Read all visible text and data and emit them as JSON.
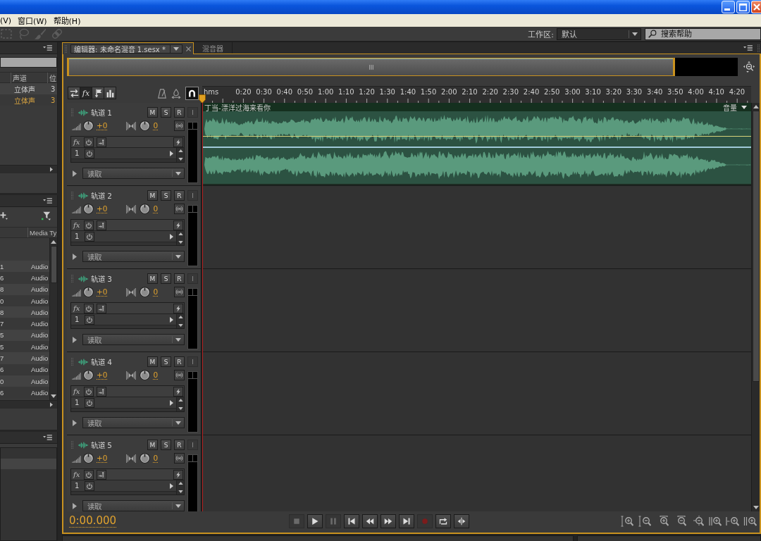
{
  "window": {
    "controls": [
      {
        "kind": "minimize"
      },
      {
        "kind": "maximize"
      },
      {
        "kind": "close"
      }
    ]
  },
  "menu_bar": {
    "items": [
      {
        "label": "(V)"
      },
      {
        "label": "窗口(W)"
      },
      {
        "label": "帮助(H)"
      }
    ]
  },
  "toolbar": {
    "tools": [
      {
        "kind": "marquee",
        "disabled": true
      },
      {
        "kind": "lasso",
        "disabled": true
      },
      {
        "kind": "brush",
        "disabled": true
      },
      {
        "kind": "heal",
        "disabled": true
      }
    ],
    "workspace": {
      "label": "工作区:",
      "value": "默认"
    },
    "search_help": {
      "placeholder": "搜索帮助"
    }
  },
  "files_panel": {
    "columns": [
      {
        "label": "声道"
      },
      {
        "label": "位"
      }
    ],
    "rows": [
      {
        "channels": "立体声",
        "column_3": "3",
        "highlighted": false
      },
      {
        "channels": "立体声",
        "column_3": "3",
        "highlighted": true
      }
    ]
  },
  "media_panel": {
    "columns": [
      {
        "label": "Media Ty"
      }
    ],
    "rows": [
      {
        "column_1": "1",
        "media_type": "Audio"
      },
      {
        "column_1": "6",
        "media_type": "Audio"
      },
      {
        "column_1": "8",
        "media_type": "Audio"
      },
      {
        "column_1": "0",
        "media_type": "Audio"
      },
      {
        "column_1": "8",
        "media_type": "Audio"
      },
      {
        "column_1": "7",
        "media_type": "Audio"
      },
      {
        "column_1": "5",
        "media_type": "Audio"
      },
      {
        "column_1": "5",
        "media_type": "Audio"
      },
      {
        "column_1": "7",
        "media_type": "Audio"
      },
      {
        "column_1": "6",
        "media_type": "Audio"
      },
      {
        "column_1": "0",
        "media_type": "Audio"
      },
      {
        "column_1": "6",
        "media_type": "Audio"
      }
    ]
  },
  "editor": {
    "tabs": [
      {
        "label": "编辑器: 未命名混音 1.sesx *",
        "selected": true
      },
      {
        "label": "混音器",
        "selected": false
      }
    ],
    "header_views": [
      {
        "kind": "io",
        "selected": false
      },
      {
        "kind": "fx",
        "label": "fx",
        "selected": true
      },
      {
        "kind": "sends",
        "selected": false
      },
      {
        "kind": "eq",
        "selected": false
      }
    ],
    "timeline_tools": [
      {
        "kind": "metronome",
        "selected": false
      },
      {
        "kind": "sync",
        "selected": false
      },
      {
        "kind": "snap",
        "selected": true
      }
    ],
    "ruler": {
      "unit": "hms",
      "labels": [
        "0:20",
        "0:30",
        "0:40",
        "0:50",
        "1:00",
        "1:10",
        "1:20",
        "1:30",
        "1:40",
        "1:50",
        "2:00",
        "2:10",
        "2:20",
        "2:30",
        "2:40",
        "2:50",
        "3:00",
        "3:10",
        "3:20",
        "3:30",
        "3:40",
        "3:50",
        "4:00",
        "4:10",
        "4:20"
      ]
    },
    "tracks": [
      {
        "name": "轨道 1",
        "buttons": [
          {
            "label": "M",
            "disabled": false
          },
          {
            "label": "S",
            "disabled": false
          },
          {
            "label": "R",
            "disabled": false
          },
          {
            "label": "I",
            "disabled": true
          }
        ],
        "volume": "+0",
        "pan": "0",
        "rack_label": "fx",
        "slot": "1",
        "automation": "读取",
        "clip": {
          "name": "丁当-漂洋过海来看你",
          "envelope": "音量"
        }
      },
      {
        "name": "轨道 2",
        "buttons": [
          {
            "label": "M",
            "disabled": false
          },
          {
            "label": "S",
            "disabled": false
          },
          {
            "label": "R",
            "disabled": false
          },
          {
            "label": "I",
            "disabled": true
          }
        ],
        "volume": "+0",
        "pan": "0",
        "rack_label": "fx",
        "slot": "1",
        "automation": "读取"
      },
      {
        "name": "轨道 3",
        "buttons": [
          {
            "label": "M",
            "disabled": false
          },
          {
            "label": "S",
            "disabled": false
          },
          {
            "label": "R",
            "disabled": false
          },
          {
            "label": "I",
            "disabled": true
          }
        ],
        "volume": "+0",
        "pan": "0",
        "rack_label": "fx",
        "slot": "1",
        "automation": "读取"
      },
      {
        "name": "轨道 4",
        "buttons": [
          {
            "label": "M",
            "disabled": false
          },
          {
            "label": "S",
            "disabled": false
          },
          {
            "label": "R",
            "disabled": false
          },
          {
            "label": "I",
            "disabled": true
          }
        ],
        "volume": "+0",
        "pan": "0",
        "rack_label": "fx",
        "slot": "1",
        "automation": "读取"
      },
      {
        "name": "轨道 5",
        "buttons": [
          {
            "label": "M",
            "disabled": false
          },
          {
            "label": "S",
            "disabled": false
          },
          {
            "label": "R",
            "disabled": false
          },
          {
            "label": "I",
            "disabled": true
          }
        ],
        "volume": "+0",
        "pan": "0",
        "rack_label": "fx",
        "slot": "1",
        "automation": "读取"
      }
    ],
    "time": "0:00.000",
    "transport": [
      {
        "kind": "stop",
        "disabled": true
      },
      {
        "kind": "play",
        "disabled": false
      },
      {
        "kind": "pause",
        "disabled": true
      },
      {
        "kind": "to_start",
        "disabled": false
      },
      {
        "kind": "rewind",
        "disabled": false
      },
      {
        "kind": "forward",
        "disabled": false
      },
      {
        "kind": "to_end",
        "disabled": false
      },
      {
        "kind": "record",
        "disabled": true
      },
      {
        "kind": "loop",
        "disabled": false
      },
      {
        "kind": "skip",
        "disabled": false
      }
    ],
    "zoom": [
      {
        "kind": "in_amplitude"
      },
      {
        "kind": "out_amplitude"
      },
      {
        "kind": "in_time"
      },
      {
        "kind": "out_time"
      },
      {
        "kind": "out_full"
      },
      {
        "kind": "in_start"
      },
      {
        "kind": "in_end"
      },
      {
        "kind": "selection"
      }
    ]
  }
}
